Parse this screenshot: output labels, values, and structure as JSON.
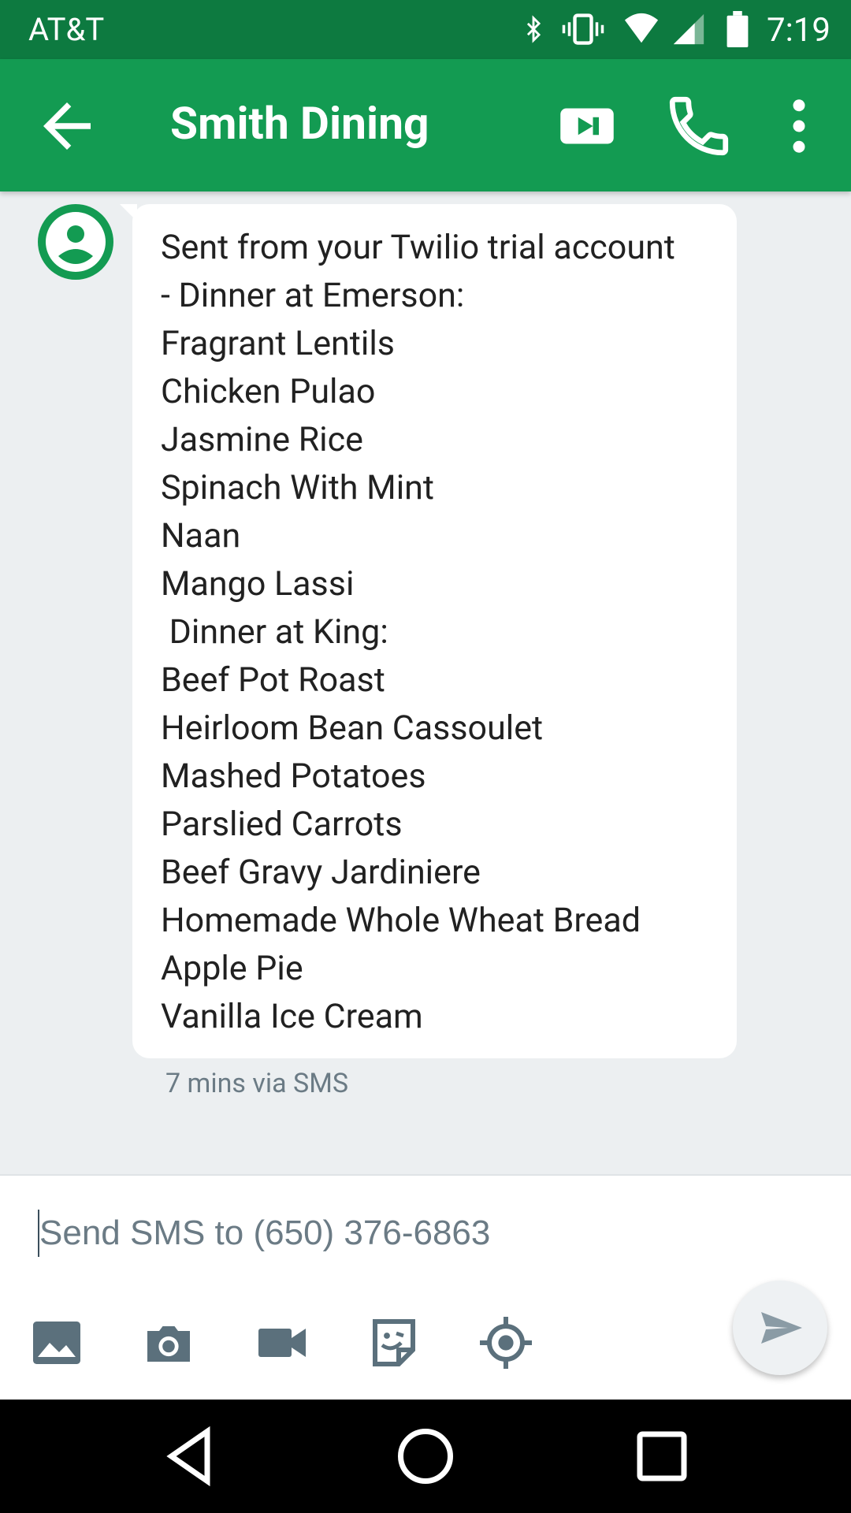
{
  "status_bar": {
    "carrier": "AT&T",
    "time": "7:19",
    "icons": [
      "bluetooth-icon",
      "vibrate-icon",
      "wifi-icon",
      "signal-icon",
      "battery-icon"
    ]
  },
  "app_bar": {
    "title": "Smith Dining",
    "icons": [
      "back-arrow-icon",
      "video-call-icon",
      "phone-icon",
      "more-vert-icon"
    ]
  },
  "message": {
    "text": "Sent from your Twilio trial account\n- Dinner at Emerson:\nFragrant Lentils\nChicken Pulao\nJasmine Rice\nSpinach With Mint\nNaan\nMango Lassi\n Dinner at King:\nBeef Pot Roast\nHeirloom Bean Cassoulet\nMashed Potatoes\nParslied Carrots\nBeef Gravy Jardiniere\nHomemade Whole Wheat Bread\nApple Pie\nVanilla Ice Cream",
    "meta": "7 mins via SMS"
  },
  "compose": {
    "placeholder": "Send SMS to (650) 376-6863",
    "value": "",
    "tools": [
      "gallery-icon",
      "camera-icon",
      "video-camera-icon",
      "sticker-icon",
      "location-icon"
    ],
    "send_icon": "send-icon"
  },
  "nav_bar": {
    "buttons": [
      "back-triangle-icon",
      "home-circle-icon",
      "recents-square-icon"
    ]
  },
  "colors": {
    "status_bar": "#0d7a40",
    "app_bar": "#139b52",
    "background": "#eceff1",
    "bubble": "#ffffff",
    "icon_gray": "#5b707c"
  }
}
